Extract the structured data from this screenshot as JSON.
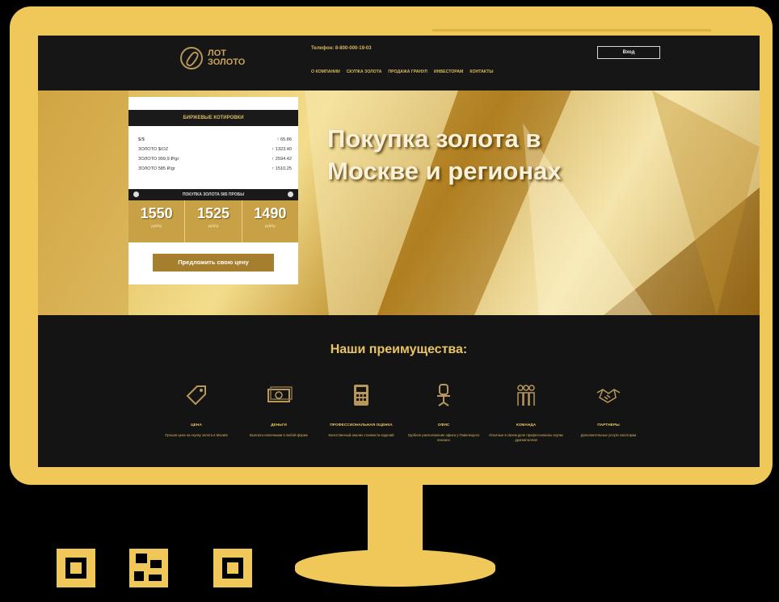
{
  "header": {
    "logo_line1": "ЛОТ",
    "logo_line2": "ЗОЛОТО",
    "phone": "Телефон: 8-800-000-19-03",
    "nav": [
      "О КОМПАНИИ",
      "СКУПКА ЗОЛОТА",
      "ПРОДАЖА ГРАНУЛ",
      "ИНВЕСТОРАМ",
      "КОНТАКТЫ"
    ],
    "login_label": "Вход"
  },
  "quotes": {
    "title": "БИРЖЕВЫЕ КОТИРОВКИ",
    "rows": [
      {
        "name": "$/$",
        "value": "↑ 65.86"
      },
      {
        "name": "ЗОЛОТО $/ОZ",
        "value": "↑ 1323.40"
      },
      {
        "name": "ЗОЛОТО 999,9 ₽/gr",
        "value": "↑ 2594.42"
      },
      {
        "name": "ЗОЛОТО 585 ₽/gr",
        "value": "↑ 1510.25"
      }
    ],
    "subtitle": "ПОКУПКА ЗОЛОТА 585 ПРОБЫ",
    "prices": [
      {
        "value": "1550",
        "unit": "руб/гр"
      },
      {
        "value": "1525",
        "unit": "руб/гр"
      },
      {
        "value": "1490",
        "unit": "руб/гр"
      }
    ],
    "offer_button": "Предложить свою цену"
  },
  "hero": {
    "heading_line1": "Покупка золота в",
    "heading_line2": "Москве и регионах"
  },
  "advantages": {
    "title": "Наши преимущества:",
    "items": [
      {
        "icon": "price-tag-icon",
        "title": "ЦЕНА",
        "desc": "Лучшая цена на скупку золота в Москве"
      },
      {
        "icon": "money-icon",
        "title": "ДЕНЬГИ",
        "desc": "Выплата наличными в любой форме"
      },
      {
        "icon": "calculator-icon",
        "title": "ПРОФЕССИОНАЛЬНАЯ ОЦЕНКА",
        "desc": "Качественный анализ стоимости изделий"
      },
      {
        "icon": "office-chair-icon",
        "title": "ОФИС",
        "desc": "Удобное расположение офиса у Павелецкого вокзала"
      },
      {
        "icon": "team-icon",
        "title": "КОМАНДА",
        "desc": "Опытные в своем деле профессионалы скупки драгметаллов"
      },
      {
        "icon": "handshake-icon",
        "title": "ПАРТНЕРЫ",
        "desc": "Дополнительные услуги золоторам"
      }
    ]
  },
  "colors": {
    "accent": "#e8c463",
    "frame": "#f0c85a",
    "dark": "#141414"
  }
}
